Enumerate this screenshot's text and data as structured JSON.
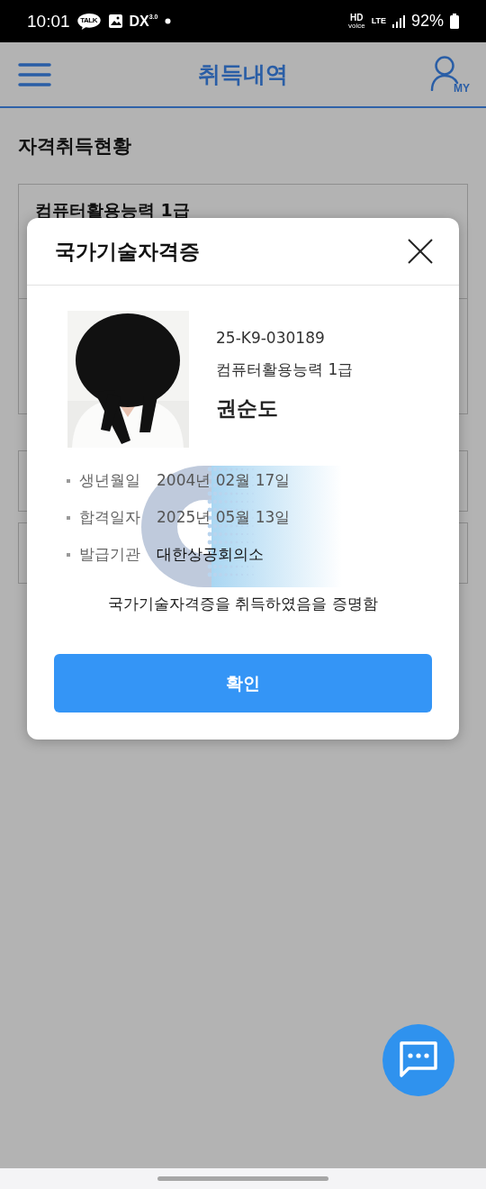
{
  "status_bar": {
    "time": "10:01",
    "talk_badge": "TALK",
    "app_badge": "DX",
    "app_badge_version": "3.0",
    "hd_label": "HD",
    "hd_sublabel": "voice",
    "network": "LTE",
    "battery": "92%"
  },
  "header": {
    "title": "취득내역",
    "account_label": "MY"
  },
  "page": {
    "section_title": "자격취득현황",
    "cards": [
      {
        "kind": "tall",
        "title": "컴퓨터활용능력 1급"
      },
      {
        "kind": "tall"
      },
      {
        "kind": "short"
      },
      {
        "kind": "short"
      }
    ]
  },
  "modal": {
    "title": "국가기술자격증",
    "certificate_number": "25-K9-030189",
    "qualification": "컴퓨터활용능력 1급",
    "holder_name": "권순도",
    "details": [
      {
        "label": "생년월일",
        "value": "2004년 02월 17일"
      },
      {
        "label": "합격일자",
        "value": "2025년 05월 13일"
      },
      {
        "label": "발급기관",
        "value": "대한상공회의소"
      }
    ],
    "statement": "국가기술자격증을 취득하였음을 증명함",
    "confirm_button": "확인"
  }
}
